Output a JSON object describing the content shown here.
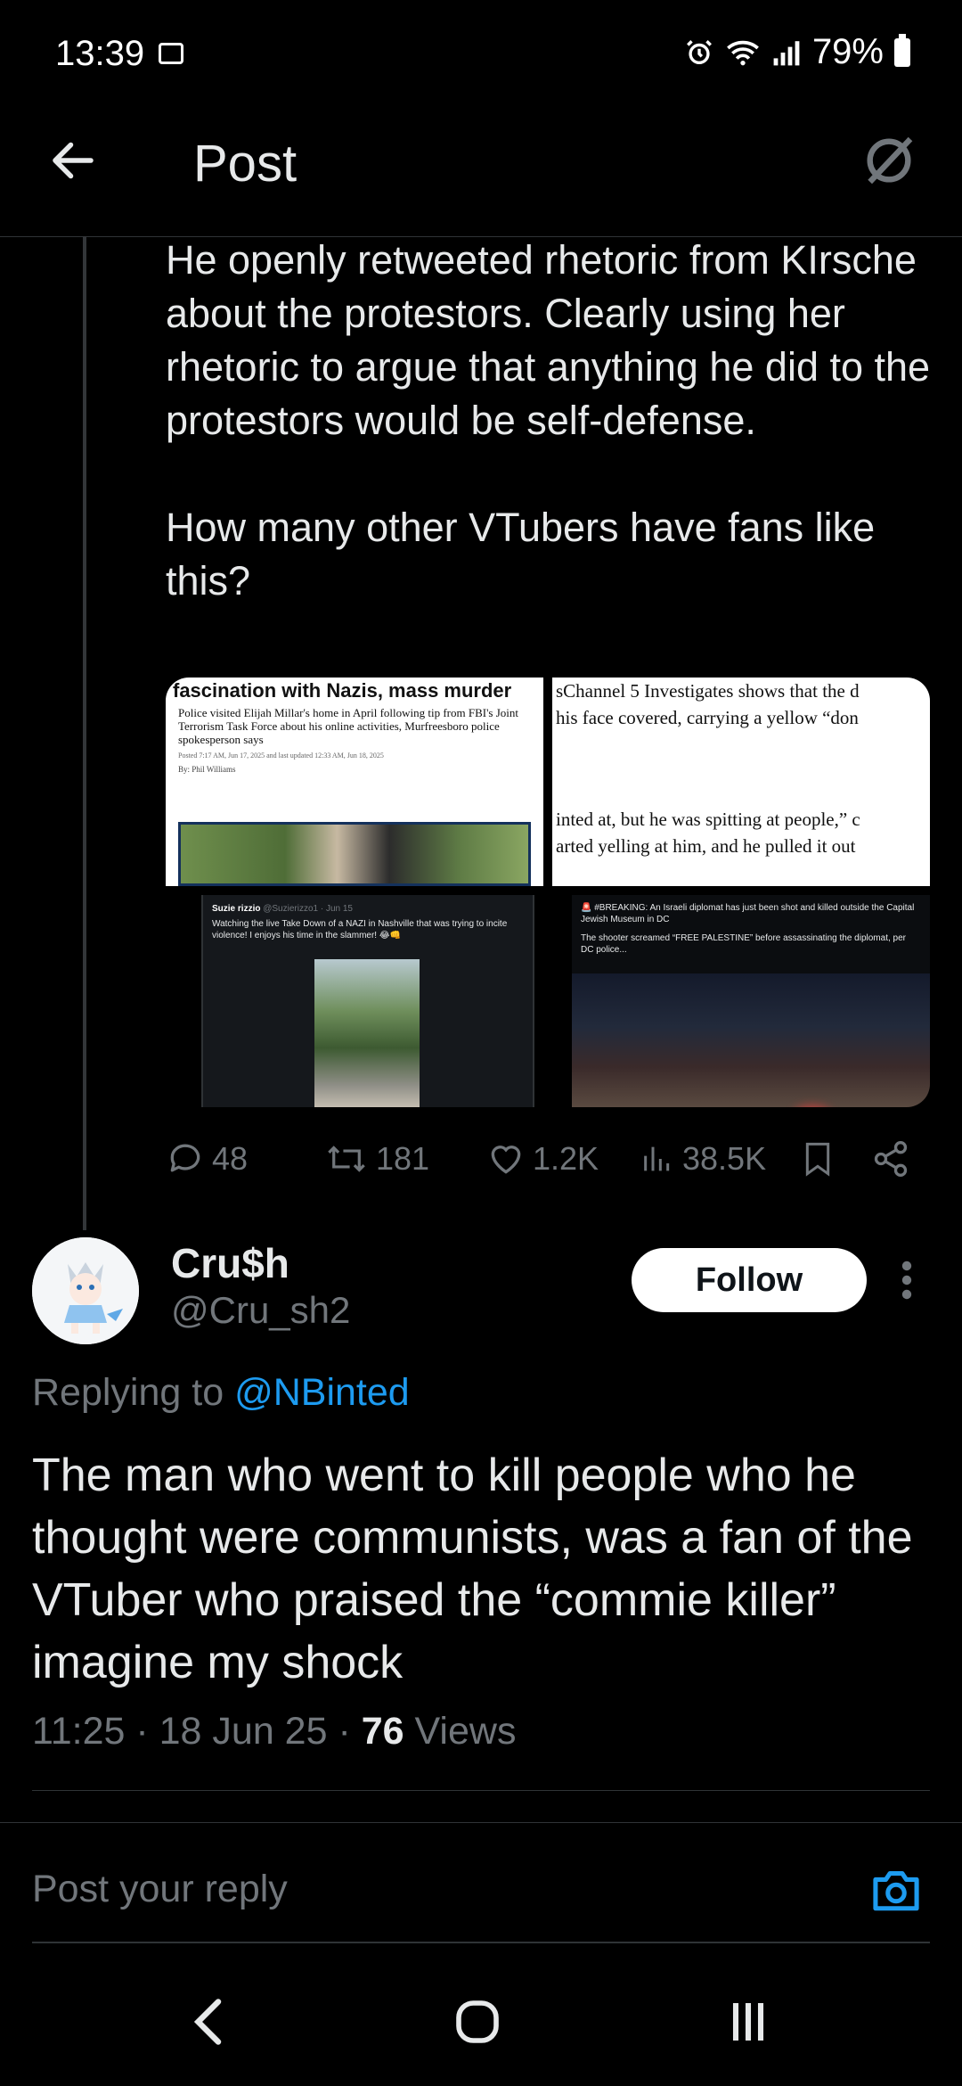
{
  "status_bar": {
    "time": "13:39",
    "battery": "79%"
  },
  "header": {
    "title": "Post"
  },
  "parent_tweet": {
    "text": "He openly retweeted rhetoric from KIrsche about the protestors. Clearly using her rhetoric to argue that anything he did to the protestors would be self-defense.\n\nHow many other VTubers have fans like this?",
    "media": {
      "m1": {
        "headline": "fascination with Nazis, mass murder",
        "body": "Police visited Elijah Millar's home in April following tip from FBI's Joint Terrorism Task Force about his online activities, Murfreesboro police spokesperson says",
        "meta": "Posted 7:17 AM, Jun 17, 2025 and last updated 12:33 AM, Jun 18, 2025",
        "byline": "By: Phil Williams"
      },
      "m2": {
        "line1": "sChannel 5 Investigates shows that the d",
        "line2": " his face covered, carrying a yellow “don",
        "line3": "inted at, but he was spitting at people,” c",
        "line4": "arted yelling at him, and he pulled it out"
      },
      "m3": {
        "user": "Suzie rizzio",
        "handle": "@Suzierizzo1 · Jun 15",
        "text": "Watching the live Take Down of a NAZI in Nashville that was trying to incite violence! I enjoys his time in the slammer! 😂👊"
      },
      "m4": {
        "text1": "🚨 #BREAKING: An Israeli diplomat has just been shot and killed outside the Capital Jewish Museum in DC",
        "text2": "The shooter screamed “FREE PALESTINE” before assassinating the diplomat, per DC police..."
      }
    },
    "actions": {
      "replies": "48",
      "reposts": "181",
      "likes": "1.2K",
      "views": "38.5K"
    }
  },
  "reply_tweet": {
    "name": "Cru$h",
    "handle": "@Cru_sh2",
    "follow_label": "Follow",
    "replying_prefix": "Replying to ",
    "replying_to": "@NBinted",
    "text": "The man who went to kill people who he thought were communists, was a fan of the VTuber who praised the “commie killer” imagine my shock",
    "time": "11:25 · 18 Jun 25 · ",
    "views_count": "76",
    "views_label": " Views"
  },
  "reply_box": {
    "placeholder": "Post your reply"
  },
  "colors": {
    "accent": "#1d9bf0",
    "background": "#000000",
    "muted": "#71767b"
  }
}
